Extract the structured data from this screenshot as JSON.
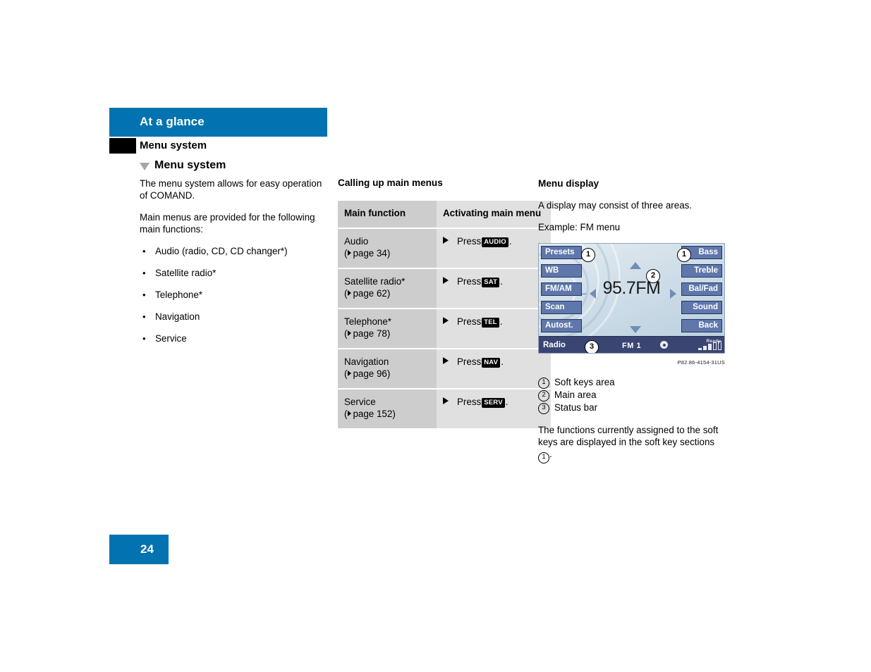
{
  "header": {
    "chapter_band_title": "At a glance",
    "chapter_title": "Menu system",
    "section_title": "Menu system",
    "band_color": "#0273b0"
  },
  "left_column": {
    "intro_paragraph": "The menu system allows for easy operation of COMAND.",
    "list_lead": "Main menus are provided for the following main functions:",
    "bullet": "•",
    "items": [
      {
        "label": "Audio (radio, CD, CD changer*)"
      },
      {
        "label": "Satellite radio*"
      },
      {
        "label": "Telephone*"
      },
      {
        "label": "Navigation"
      },
      {
        "label": "Service"
      }
    ]
  },
  "middle_column": {
    "heading": "Calling up main menus",
    "table": {
      "headers": [
        "Main function",
        "Activating main menu"
      ],
      "rows": [
        {
          "function": "Audio",
          "page_prefix": "(",
          "page_label": "page 34)",
          "action_verb": "Press",
          "key": "AUDIO",
          "action_suffix": "."
        },
        {
          "function": "Satellite radio*",
          "page_prefix": "(",
          "page_label": "page 62)",
          "action_verb": "Press",
          "key": "SAT",
          "action_suffix": "."
        },
        {
          "function": "Telephone*",
          "page_prefix": "(",
          "page_label": "page 78)",
          "action_verb": "Press",
          "key": "TEL",
          "action_suffix": "."
        },
        {
          "function": "Navigation",
          "page_prefix": "(",
          "page_label": "page 96)",
          "action_verb": "Press",
          "key": "NAV",
          "action_suffix": "."
        },
        {
          "function": "Service",
          "page_prefix": "(",
          "page_label": "page 152)",
          "action_verb": "Press",
          "key": "SERV",
          "action_suffix": "."
        }
      ]
    }
  },
  "right_column": {
    "heading": "Menu display",
    "paragraph_1": "A display may consist of three areas.",
    "paragraph_2": "Example: FM menu",
    "figure_code": "P82.86-4154-31US",
    "legend": [
      {
        "num": "1",
        "label": "Soft keys area"
      },
      {
        "num": "2",
        "label": "Main area"
      },
      {
        "num": "3",
        "label": "Status bar"
      }
    ],
    "closing_text_before": "The functions currently assigned to the soft keys are displayed in the soft key sections ",
    "closing_ref": "1",
    "closing_text_after": ".",
    "comand_display": {
      "soft_keys_left": [
        "Presets",
        "WB",
        "FM/AM",
        "Scan",
        "Autost."
      ],
      "soft_keys_right": [
        "Bass",
        "Treble",
        "Bal/Fad",
        "Sound",
        "Back"
      ],
      "main_value": "95.7FM",
      "minus_sign": "–",
      "plus_sign": "+",
      "callouts": [
        {
          "id": "1a",
          "num": "1"
        },
        {
          "id": "1b",
          "num": "1"
        },
        {
          "id": "2",
          "num": "2"
        },
        {
          "id": "3",
          "num": "3"
        }
      ],
      "status_bar": {
        "source": "Radio",
        "band": "FM 1",
        "ready_label": "Ready"
      },
      "colors": {
        "soft_key_fill": "#5f77ab",
        "soft_key_border": "#26365e",
        "status_bar": "#3b4572",
        "main_area_top": "#e3ecf3",
        "main_area_bottom": "#b9cddd"
      }
    }
  },
  "footer": {
    "page_number": "24"
  }
}
